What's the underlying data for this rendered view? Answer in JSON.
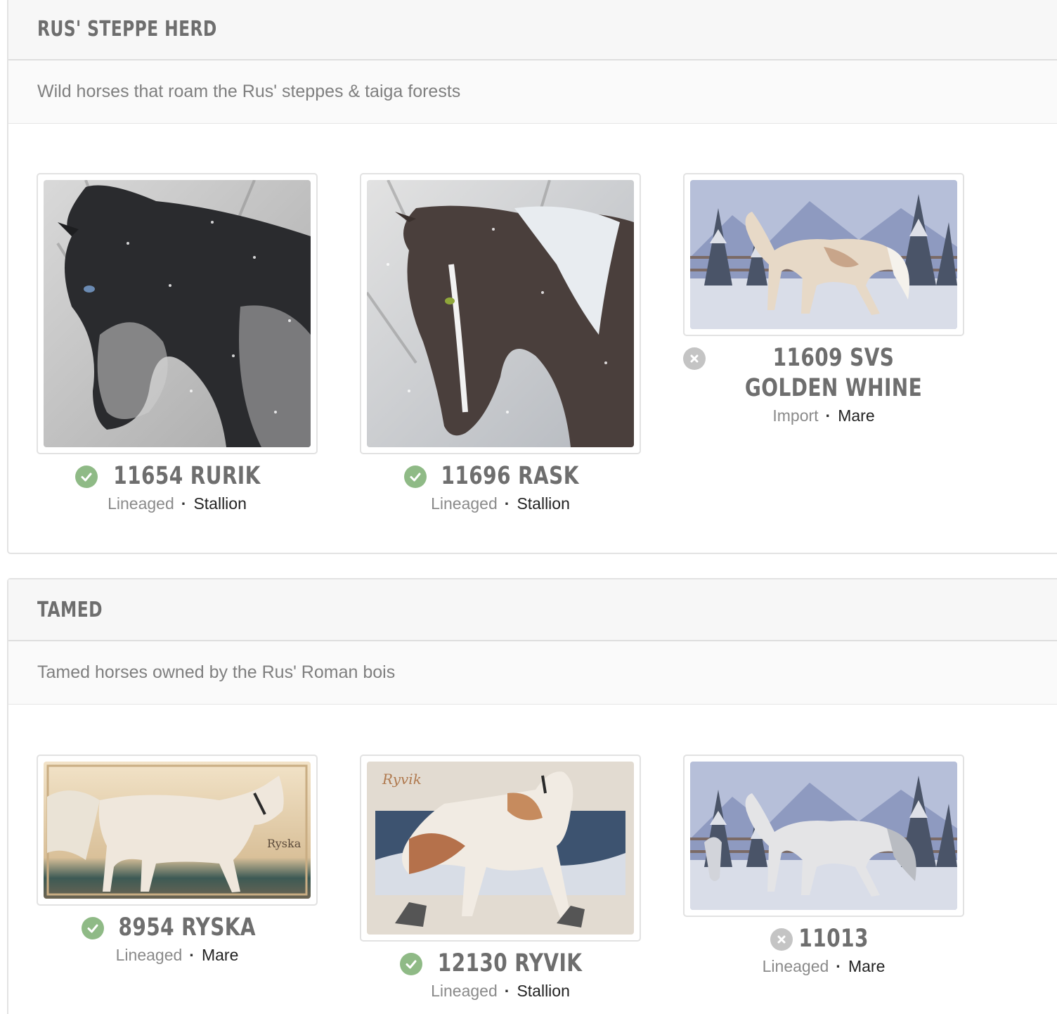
{
  "sections": [
    {
      "title": "RUS' STEPPE HERD",
      "description": "Wild horses that roam the Rus' steppes & taiga forests",
      "horses": [
        {
          "id_name": "11654 RURIK",
          "type": "Lineaged",
          "sex": "Stallion",
          "status": "check-circle-icon",
          "image": "horse-portrait-black"
        },
        {
          "id_name": "11696 RASK",
          "type": "Lineaged",
          "sex": "Stallion",
          "status": "check-circle-icon",
          "image": "horse-portrait-pinto"
        },
        {
          "id_name": "11609 SVS GOLDEN WHINE",
          "type": "Import",
          "sex": "Mare",
          "status": "x-circle-icon",
          "image": "horse-trotting-snow-cream"
        }
      ]
    },
    {
      "title": "TAMED",
      "description": "Tamed horses owned by the Rus' Roman bois",
      "horses": [
        {
          "id_name": "8954 RYSKA",
          "type": "Lineaged",
          "sex": "Mare",
          "status": "check-circle-icon",
          "image": "horse-walking-golden"
        },
        {
          "id_name": "12130 RYVIK",
          "type": "Lineaged",
          "sex": "Stallion",
          "status": "check-circle-icon",
          "image": "horse-with-dogs-ryvik"
        },
        {
          "id_name": "11013",
          "type": "Lineaged",
          "sex": "Mare",
          "status": "x-circle-icon",
          "image": "horse-trotting-snow-grey"
        }
      ]
    }
  ],
  "artwork_text": {
    "ryska_signature": "Ryska",
    "ryvik_signature": "Ryvik"
  },
  "colors": {
    "check": "#8fba86",
    "x": "#c4c4c4",
    "title": "#6e6e6e"
  }
}
